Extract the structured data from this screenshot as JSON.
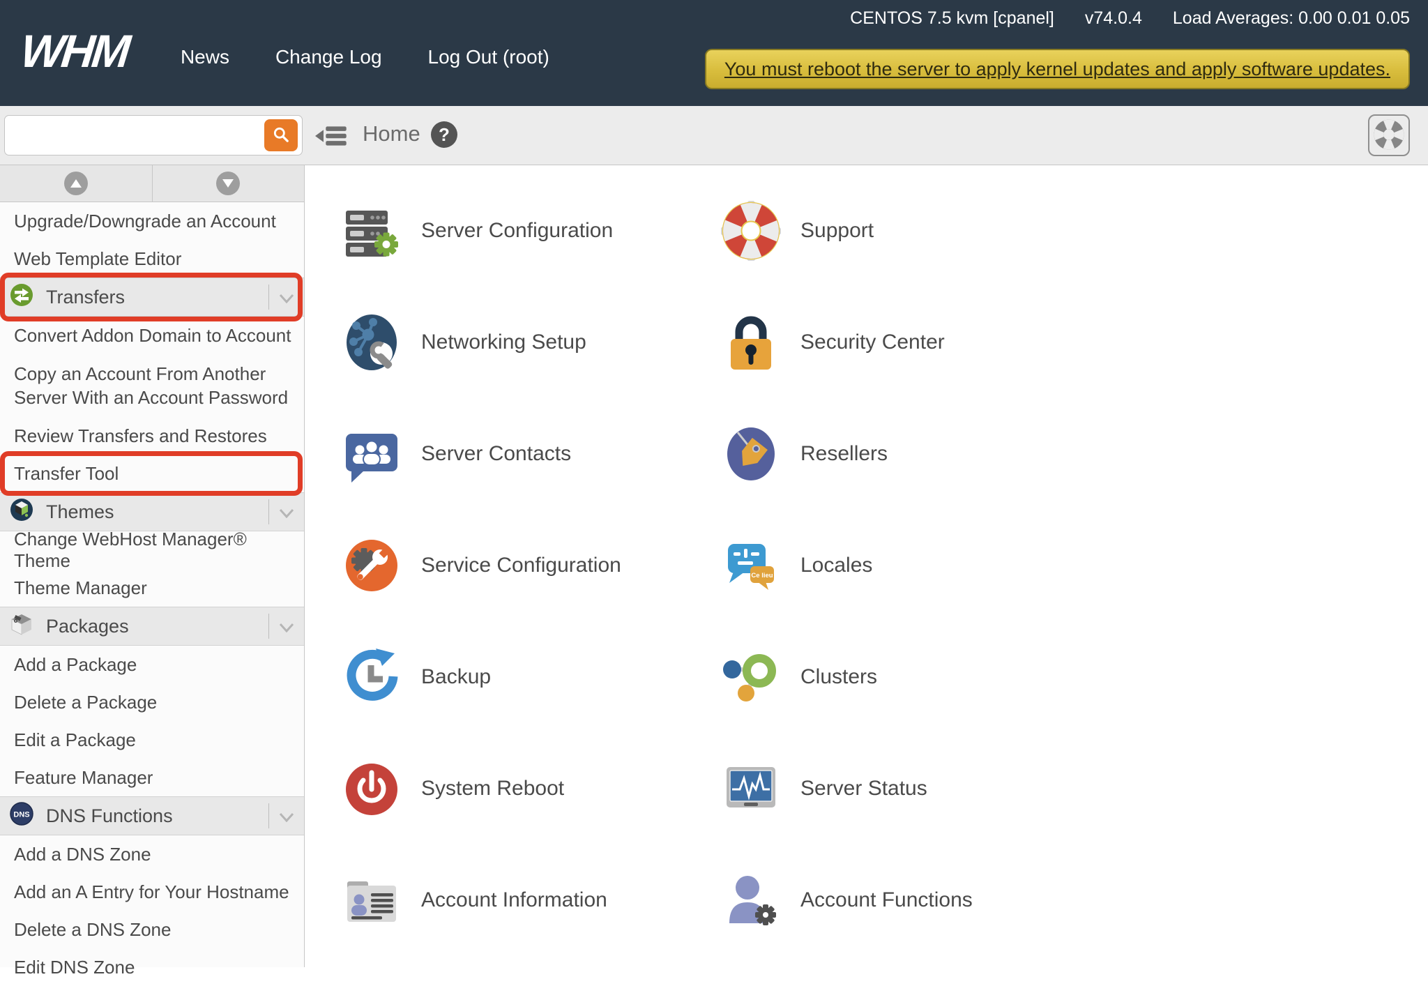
{
  "topbar": {
    "logo": "WHM",
    "nav": [
      {
        "label": "News"
      },
      {
        "label": "Change Log"
      },
      {
        "label": "Log Out (root)"
      }
    ],
    "system_info": "CENTOS 7.5 kvm [cpanel]",
    "version": "v74.0.4",
    "load_averages": "Load Averages: 0.00 0.01 0.05",
    "alert_text": "You must reboot the server to apply kernel updates and apply software updates."
  },
  "header": {
    "search_placeholder": "",
    "breadcrumb": "Home",
    "help_symbol": "?"
  },
  "sidebar": {
    "dns_badge": "DNS",
    "items": [
      {
        "type": "link",
        "label": "Upgrade/Downgrade an Account"
      },
      {
        "type": "link",
        "label": "Web Template Editor"
      },
      {
        "type": "section",
        "label": "Transfers",
        "icon": "transfers-icon",
        "highlighted": true
      },
      {
        "type": "link",
        "label": "Convert Addon Domain to Account"
      },
      {
        "type": "link",
        "label": "Copy an Account From Another Server With an Account Password"
      },
      {
        "type": "link",
        "label": "Review Transfers and Restores"
      },
      {
        "type": "link",
        "label": "Transfer Tool",
        "highlighted": true
      },
      {
        "type": "section",
        "label": "Themes",
        "icon": "themes-icon"
      },
      {
        "type": "link",
        "label": "Change WebHost Manager® Theme"
      },
      {
        "type": "link",
        "label": "Theme Manager"
      },
      {
        "type": "section",
        "label": "Packages",
        "icon": "packages-icon"
      },
      {
        "type": "link",
        "label": "Add a Package"
      },
      {
        "type": "link",
        "label": "Delete a Package"
      },
      {
        "type": "link",
        "label": "Edit a Package"
      },
      {
        "type": "link",
        "label": "Feature Manager"
      },
      {
        "type": "section",
        "label": "DNS Functions",
        "icon": "dns-icon"
      },
      {
        "type": "link",
        "label": "Add a DNS Zone"
      },
      {
        "type": "link",
        "label": "Add an A Entry for Your Hostname"
      },
      {
        "type": "link",
        "label": "Delete a DNS Zone"
      },
      {
        "type": "link",
        "label": "Edit DNS Zone"
      }
    ]
  },
  "main": {
    "tiles": [
      {
        "label": "Server Configuration",
        "icon": "server-configuration-icon"
      },
      {
        "label": "Support",
        "icon": "support-icon"
      },
      {
        "label": "Networking Setup",
        "icon": "networking-setup-icon"
      },
      {
        "label": "Security Center",
        "icon": "security-center-icon"
      },
      {
        "label": "Server Contacts",
        "icon": "server-contacts-icon"
      },
      {
        "label": "Resellers",
        "icon": "resellers-icon"
      },
      {
        "label": "Service Configuration",
        "icon": "service-configuration-icon"
      },
      {
        "label": "Locales",
        "icon": "locales-icon",
        "icon_text": "Ce lieu"
      },
      {
        "label": "Backup",
        "icon": "backup-icon"
      },
      {
        "label": "Clusters",
        "icon": "clusters-icon"
      },
      {
        "label": "System Reboot",
        "icon": "system-reboot-icon"
      },
      {
        "label": "Server Status",
        "icon": "server-status-icon"
      },
      {
        "label": "Account Information",
        "icon": "account-information-icon"
      },
      {
        "label": "Account Functions",
        "icon": "account-functions-icon"
      }
    ]
  },
  "colors": {
    "topbar_bg": "#2b3947",
    "alert_yellow": "#d8bd3d",
    "highlight_red": "#e03d27",
    "search_orange": "#e87a27"
  }
}
